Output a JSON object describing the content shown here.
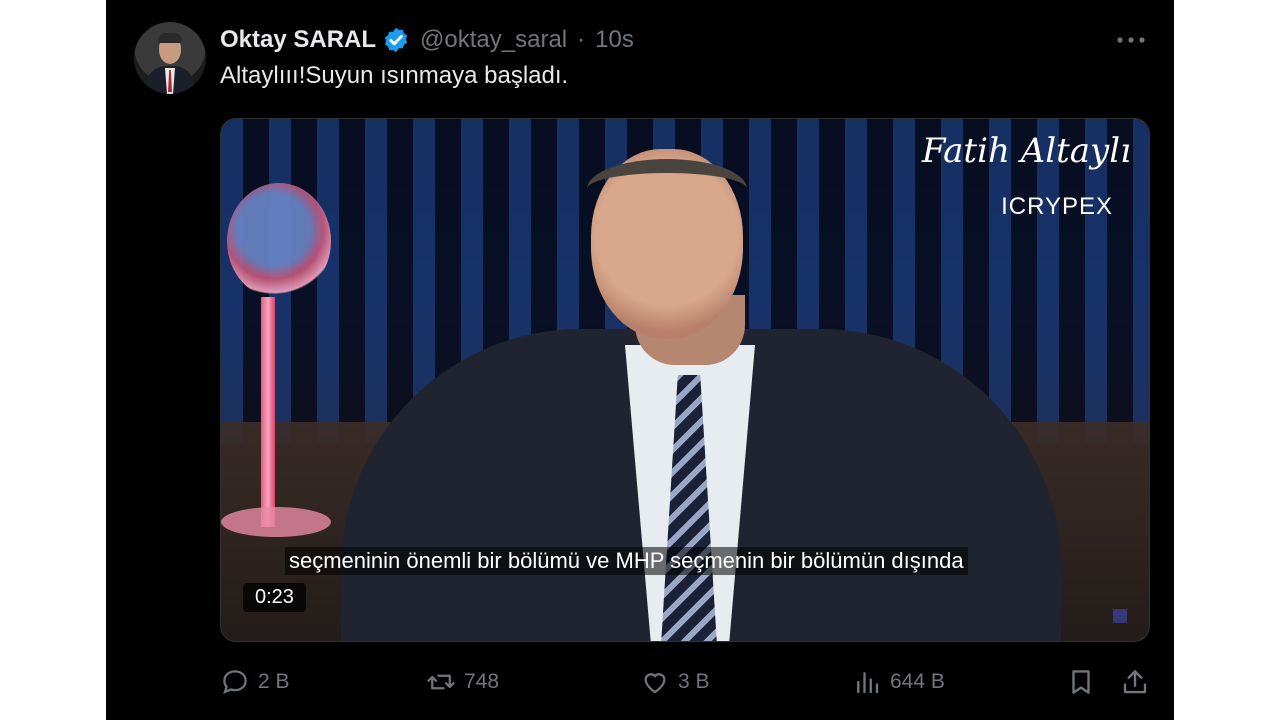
{
  "author": {
    "name": "Oktay SARAL",
    "handle": "@oktay_saral",
    "time": "10s",
    "verified": true
  },
  "tweet": {
    "text": "Altaylııı!Suyun ısınmaya başladı."
  },
  "video": {
    "signature": "Fatih Altaylı",
    "brand": "ICRYPEX",
    "subtitle": "seçmeninin önemli bir bölümü ve MHP seçmenin bir bölümün dışında",
    "duration": "0:23"
  },
  "actions": {
    "replies": "2 B",
    "reposts": "748",
    "likes": "3 B",
    "views": "644 B"
  },
  "colors": {
    "background": "#000000",
    "text": "#e7e9ea",
    "muted": "#71767b",
    "verified": "#1d9bf0"
  }
}
